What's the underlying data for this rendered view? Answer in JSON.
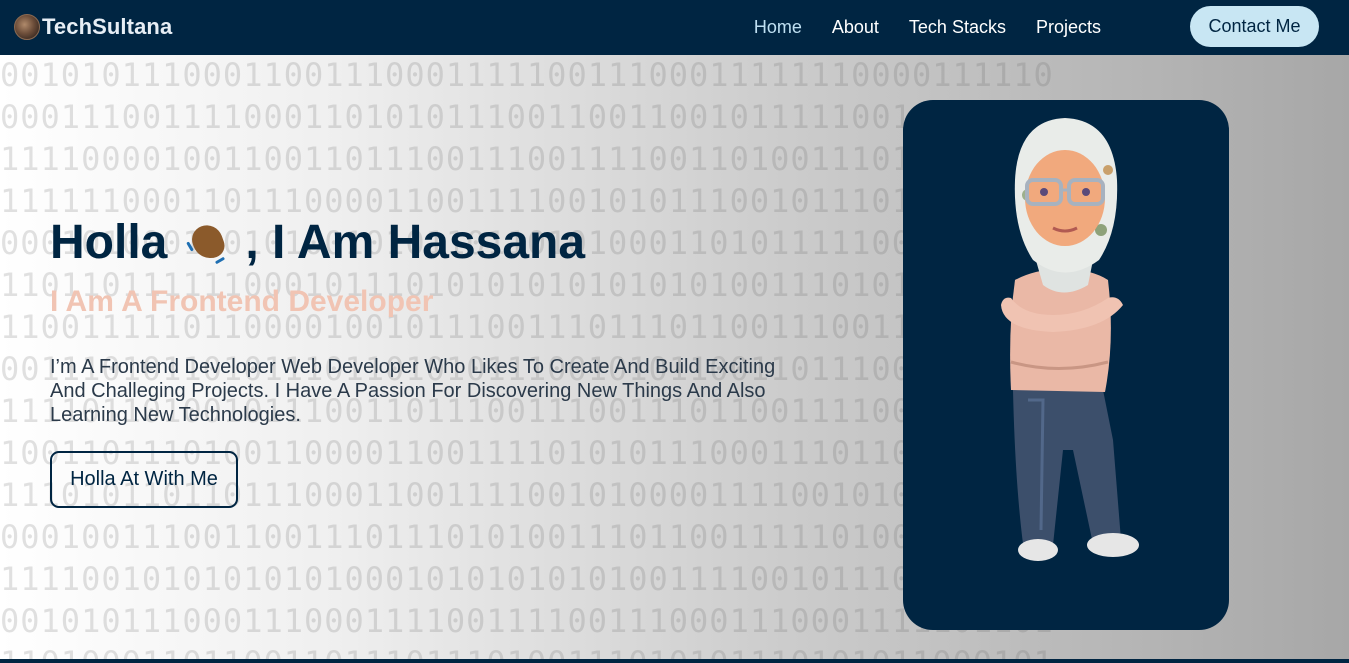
{
  "brand": {
    "name": "TechSultana",
    "logo_icon": "avatar-logo-icon"
  },
  "nav": {
    "links": [
      {
        "label": "Home",
        "active": true
      },
      {
        "label": "About",
        "active": false
      },
      {
        "label": "Tech Stacks",
        "active": false
      },
      {
        "label": "Projects",
        "active": false
      }
    ],
    "contact_label": "Contact Me"
  },
  "hero": {
    "greeting_prefix": "Holla",
    "greeting_suffix": ", I Am Hassana",
    "greeting_icon": "waving-hand-icon",
    "role": "I Am A Frontend Developer",
    "description": "I’m A Frontend Developer Web Developer Who Likes To Create And Build Exciting And Challeging Projects. I Have A Passion For Discovering New Things And Also Learning New Technologies.",
    "cta_label": "Holla At With Me",
    "avatar_icon": "hijabi-avatar-icon"
  },
  "colors": {
    "navy": "#002542",
    "accent_light_blue": "#c8e6f3",
    "role_peach": "#f1c4b3"
  }
}
